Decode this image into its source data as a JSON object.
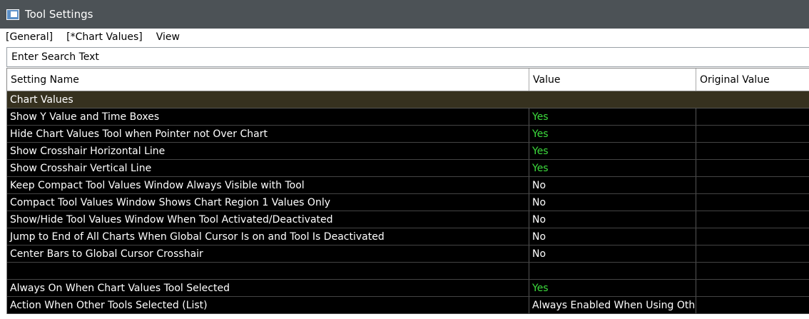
{
  "window": {
    "title": "Tool Settings"
  },
  "menu": [
    "[General]",
    "[*Chart Values]",
    "View"
  ],
  "search": {
    "placeholder": "Enter Search Text"
  },
  "columns": [
    "Setting Name",
    "Value",
    "Original Value"
  ],
  "section": "Chart Values",
  "rows": [
    {
      "name": "Show Y Value and Time Boxes",
      "value": "Yes",
      "original": ""
    },
    {
      "name": "Hide Chart Values Tool when Pointer not Over Chart",
      "value": "Yes",
      "original": ""
    },
    {
      "name": "Show Crosshair Horizontal Line",
      "value": "Yes",
      "original": ""
    },
    {
      "name": "Show Crosshair Vertical Line",
      "value": "Yes",
      "original": ""
    },
    {
      "name": "Keep Compact Tool Values Window Always Visible with Tool",
      "value": "No",
      "original": ""
    },
    {
      "name": "Compact Tool Values Window Shows Chart Region 1 Values Only",
      "value": "No",
      "original": ""
    },
    {
      "name": "Show/Hide Tool Values Window When Tool Activated/Deactivated",
      "value": "No",
      "original": ""
    },
    {
      "name": "Jump to End of All Charts When Global Cursor Is on and Tool Is Deactivated",
      "value": "No",
      "original": ""
    },
    {
      "name": "Center Bars to Global Cursor Crosshair",
      "value": "No",
      "original": ""
    },
    {
      "name": "",
      "value": "",
      "original": ""
    },
    {
      "name": "Always On When Chart Values Tool Selected",
      "value": "Yes",
      "original": ""
    },
    {
      "name": "Action When Other Tools Selected (List)",
      "value": "Always Enabled When Using Other",
      "original": ""
    }
  ],
  "colors": {
    "titlebar": "#4c5256",
    "section": "#36311f",
    "yes": "#3ddc3d",
    "row_bg": "#000000"
  },
  "icons": {
    "app": "window-icon"
  }
}
